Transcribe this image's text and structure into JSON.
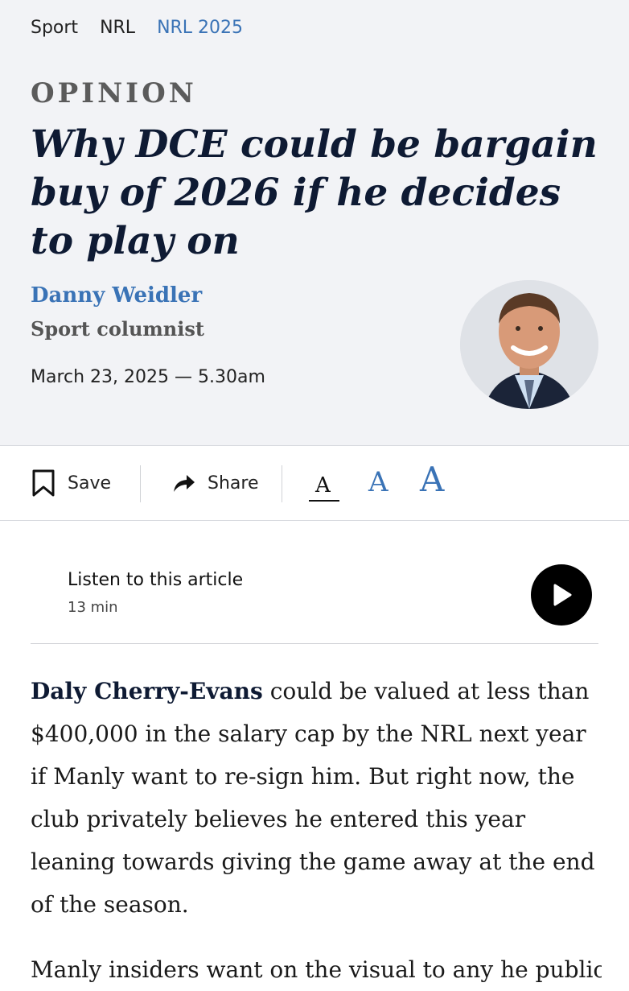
{
  "breadcrumb": {
    "items": [
      "Sport",
      "NRL",
      "NRL 2025"
    ]
  },
  "article": {
    "kicker": "OPINION",
    "headline": "Why DCE could be bargain buy of 2026 if he decides to play on",
    "author": {
      "name": "Danny Weidler",
      "role": "Sport columnist"
    },
    "dateline": "March 23, 2025 — 5.30am",
    "lead_name": "Daly Cherry-Evans",
    "lead_text": " could be valued at less than $400,000 in the salary cap by the NRL next year if Manly want to re-sign him. But right now, the club privately believes he entered this year leaning towards giving the game away at the end of the season.",
    "next_partial": "Manly insiders want on the visual to any he publicly"
  },
  "toolbar": {
    "save_label": "Save",
    "share_label": "Share",
    "font_small": "A",
    "font_medium": "A",
    "font_large": "A"
  },
  "audio": {
    "title": "Listen to this article",
    "duration": "13 min"
  },
  "colors": {
    "accent": "#3a73b6",
    "headline": "#0e1a33",
    "header_bg": "#f2f3f6"
  }
}
